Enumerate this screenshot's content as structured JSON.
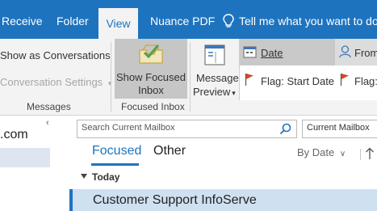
{
  "tabs": [
    {
      "label": "Receive"
    },
    {
      "label": "Folder"
    },
    {
      "label": "View"
    },
    {
      "label": "Nuance PDF"
    }
  ],
  "tellme": "Tell me what you want to do",
  "ribbon": {
    "show_as_conversations": "Show as Conversations",
    "conversation_settings": "Conversation Settings",
    "messages_group": "Messages",
    "show_focused_line1": "Show Focused",
    "show_focused_line2": "Inbox",
    "focused_group": "Focused Inbox",
    "message_preview_line1": "Message",
    "message_preview_line2": "Preview",
    "arrangement": {
      "date": "Date",
      "from": "From",
      "flag_start": "Flag: Start Date",
      "flag_due": "Flag:"
    }
  },
  "left": {
    "account": ".com",
    "collapse": "‹"
  },
  "search": {
    "placeholder": "Search Current Mailbox",
    "scope": "Current Mailbox"
  },
  "list": {
    "tabs": [
      "Focused",
      "Other"
    ],
    "sort": "By Date",
    "group": "Today",
    "selected_sender": "Customer Support InfoServe"
  },
  "colors": {
    "accent": "#1e73be",
    "flag": "#d24726"
  }
}
